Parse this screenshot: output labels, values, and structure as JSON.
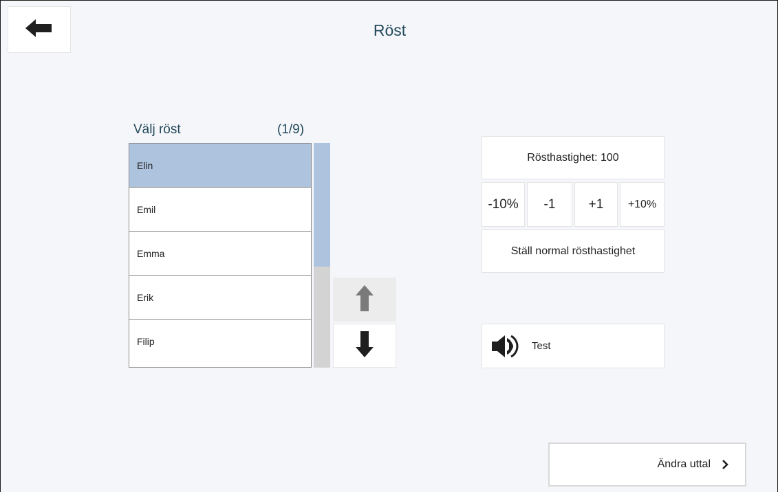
{
  "header": {
    "title": "Röst"
  },
  "voice_list": {
    "label": "Välj röst",
    "count": "(1/9)",
    "selected_index": 0,
    "items": [
      "Elin",
      "Emil",
      "Emma",
      "Erik",
      "Filip"
    ],
    "scroll_fraction": 0.55
  },
  "speed": {
    "label": "Rösthastighet: 100",
    "buttons": [
      "-10%",
      "-1",
      "+1",
      "+10%"
    ],
    "normal_label": "Ställ normal rösthastighet"
  },
  "test": {
    "label": "Test"
  },
  "next": {
    "label": "Ändra uttal"
  },
  "colors": {
    "background": "#f5f6fa",
    "selected": "#adc3de",
    "title_text": "#234a5a",
    "scrollbar_track": "#d3d3d3"
  },
  "icons": {
    "back": "arrow-left-icon",
    "scroll_up": "arrow-up-icon",
    "scroll_down": "arrow-down-icon",
    "speaker": "speaker-icon",
    "next": "chevron-right-icon"
  }
}
